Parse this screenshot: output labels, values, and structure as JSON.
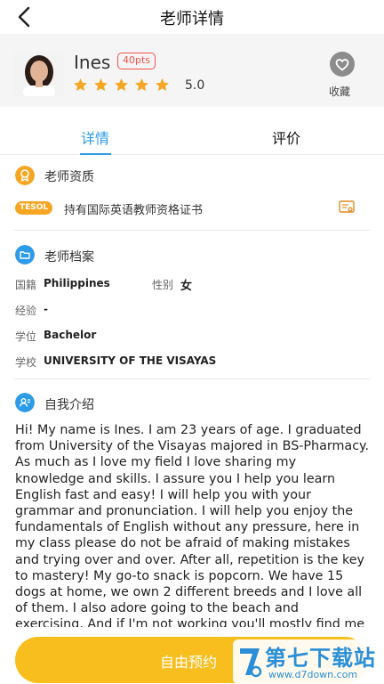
{
  "header": {
    "title": "老师详情"
  },
  "profile": {
    "name": "Ines",
    "points_badge": "40pts",
    "rating_value": "5.0",
    "stars_filled": 5,
    "stars_total": 5,
    "favorite_label": "收藏"
  },
  "tabs": [
    {
      "label": "详情",
      "active": true
    },
    {
      "label": "评价",
      "active": false
    }
  ],
  "qualification": {
    "title": "老师资质",
    "badge": "TESOL",
    "text": "持有国际英语教师资格证书"
  },
  "profile_file": {
    "title": "老师档案",
    "nationality_label": "国籍",
    "nationality_value": "Philippines",
    "gender_label": "性别",
    "gender_value": "女",
    "experience_label": "经验",
    "experience_value": "-",
    "degree_label": "学位",
    "degree_value": "Bachelor",
    "school_label": "学校",
    "school_value": "UNIVERSITY OF THE VISAYAS"
  },
  "intro": {
    "title": "自我介绍",
    "text": "Hi! My name is Ines. I am 23 years of age. I graduated from University of the Visayas majored in BS-Pharmacy. As much as I love my field I love sharing my knowledge and skills. I assure you I help you learn English fast and easy! I will help you with your grammar and pronunciation. I will help you enjoy the fundamentals of English without any pressure, here in my class please do not be afraid of making mistakes and trying over and over. After all, repetition is the key to mastery! My go-to snack is popcorn. We have 15 dogs at home, we own 2 different breeds and I love all of them. I also adore going to the beach and exercising. And if I'm not working you'll mostly find me reviewing/studying or singing and"
  },
  "cta": {
    "label": "自由预约"
  },
  "watermark": {
    "title": "第七下载站",
    "url": "www.d7down.com"
  },
  "colors": {
    "accent_blue": "#2d9be8",
    "star_orange": "#f5a623",
    "badge_red": "#f4524d",
    "cta_yellow": "#f7be1d",
    "tesol_orange": "#f6a623"
  }
}
